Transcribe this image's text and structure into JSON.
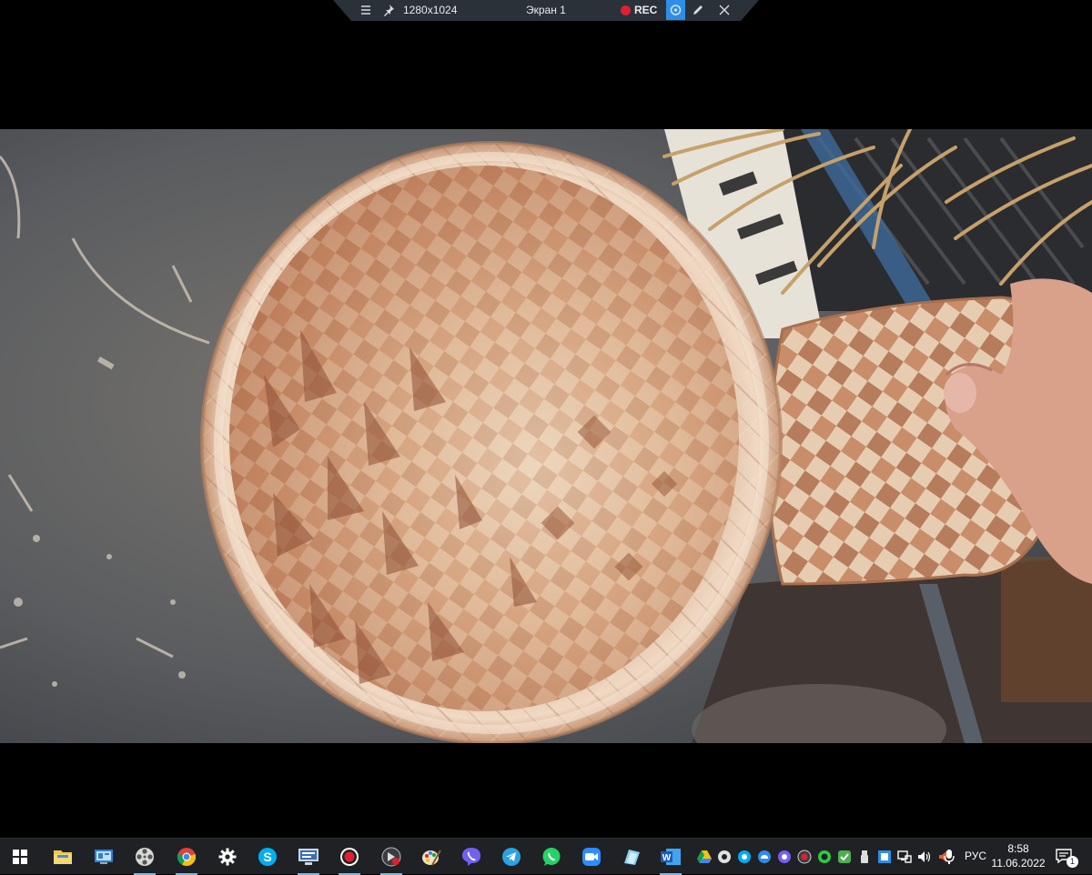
{
  "recorder": {
    "resolution": "1280x1024",
    "screen_label": "Экран 1",
    "rec_label": "REC",
    "icons": [
      "menu-icon",
      "pin-icon",
      "record-dot-icon",
      "camera-icon",
      "pencil-icon",
      "close-icon"
    ]
  },
  "video": {
    "content": "birch-bark-basket-weaving"
  },
  "taskbar": {
    "apps": [
      {
        "name": "start",
        "icon": "windows-logo-icon"
      },
      {
        "name": "file-explorer",
        "icon": "folder-icon"
      },
      {
        "name": "control-panel",
        "icon": "control-panel-icon"
      },
      {
        "name": "media-player",
        "icon": "film-reel-icon"
      },
      {
        "name": "chrome",
        "icon": "chrome-icon"
      },
      {
        "name": "settings",
        "icon": "gear-icon"
      },
      {
        "name": "skype",
        "icon": "skype-icon"
      },
      {
        "name": "screen-recorder",
        "icon": "monitor-icon"
      },
      {
        "name": "record",
        "icon": "record-icon"
      },
      {
        "name": "video-editor",
        "icon": "video-editor-icon"
      },
      {
        "name": "paint",
        "icon": "paint-icon"
      },
      {
        "name": "viber",
        "icon": "viber-icon"
      },
      {
        "name": "telegram",
        "icon": "telegram-icon"
      },
      {
        "name": "whatsapp",
        "icon": "whatsapp-icon"
      },
      {
        "name": "zoom",
        "icon": "zoom-icon"
      },
      {
        "name": "notes",
        "icon": "notes-icon"
      },
      {
        "name": "word",
        "icon": "word-icon"
      }
    ],
    "language": "РУС",
    "time": "8:58",
    "date": "11.06.2022",
    "notifications_count": "1"
  },
  "colors": {
    "taskbar_bg": "#1f2125",
    "accent": "#2e8de6",
    "record_red": "#e02030"
  }
}
